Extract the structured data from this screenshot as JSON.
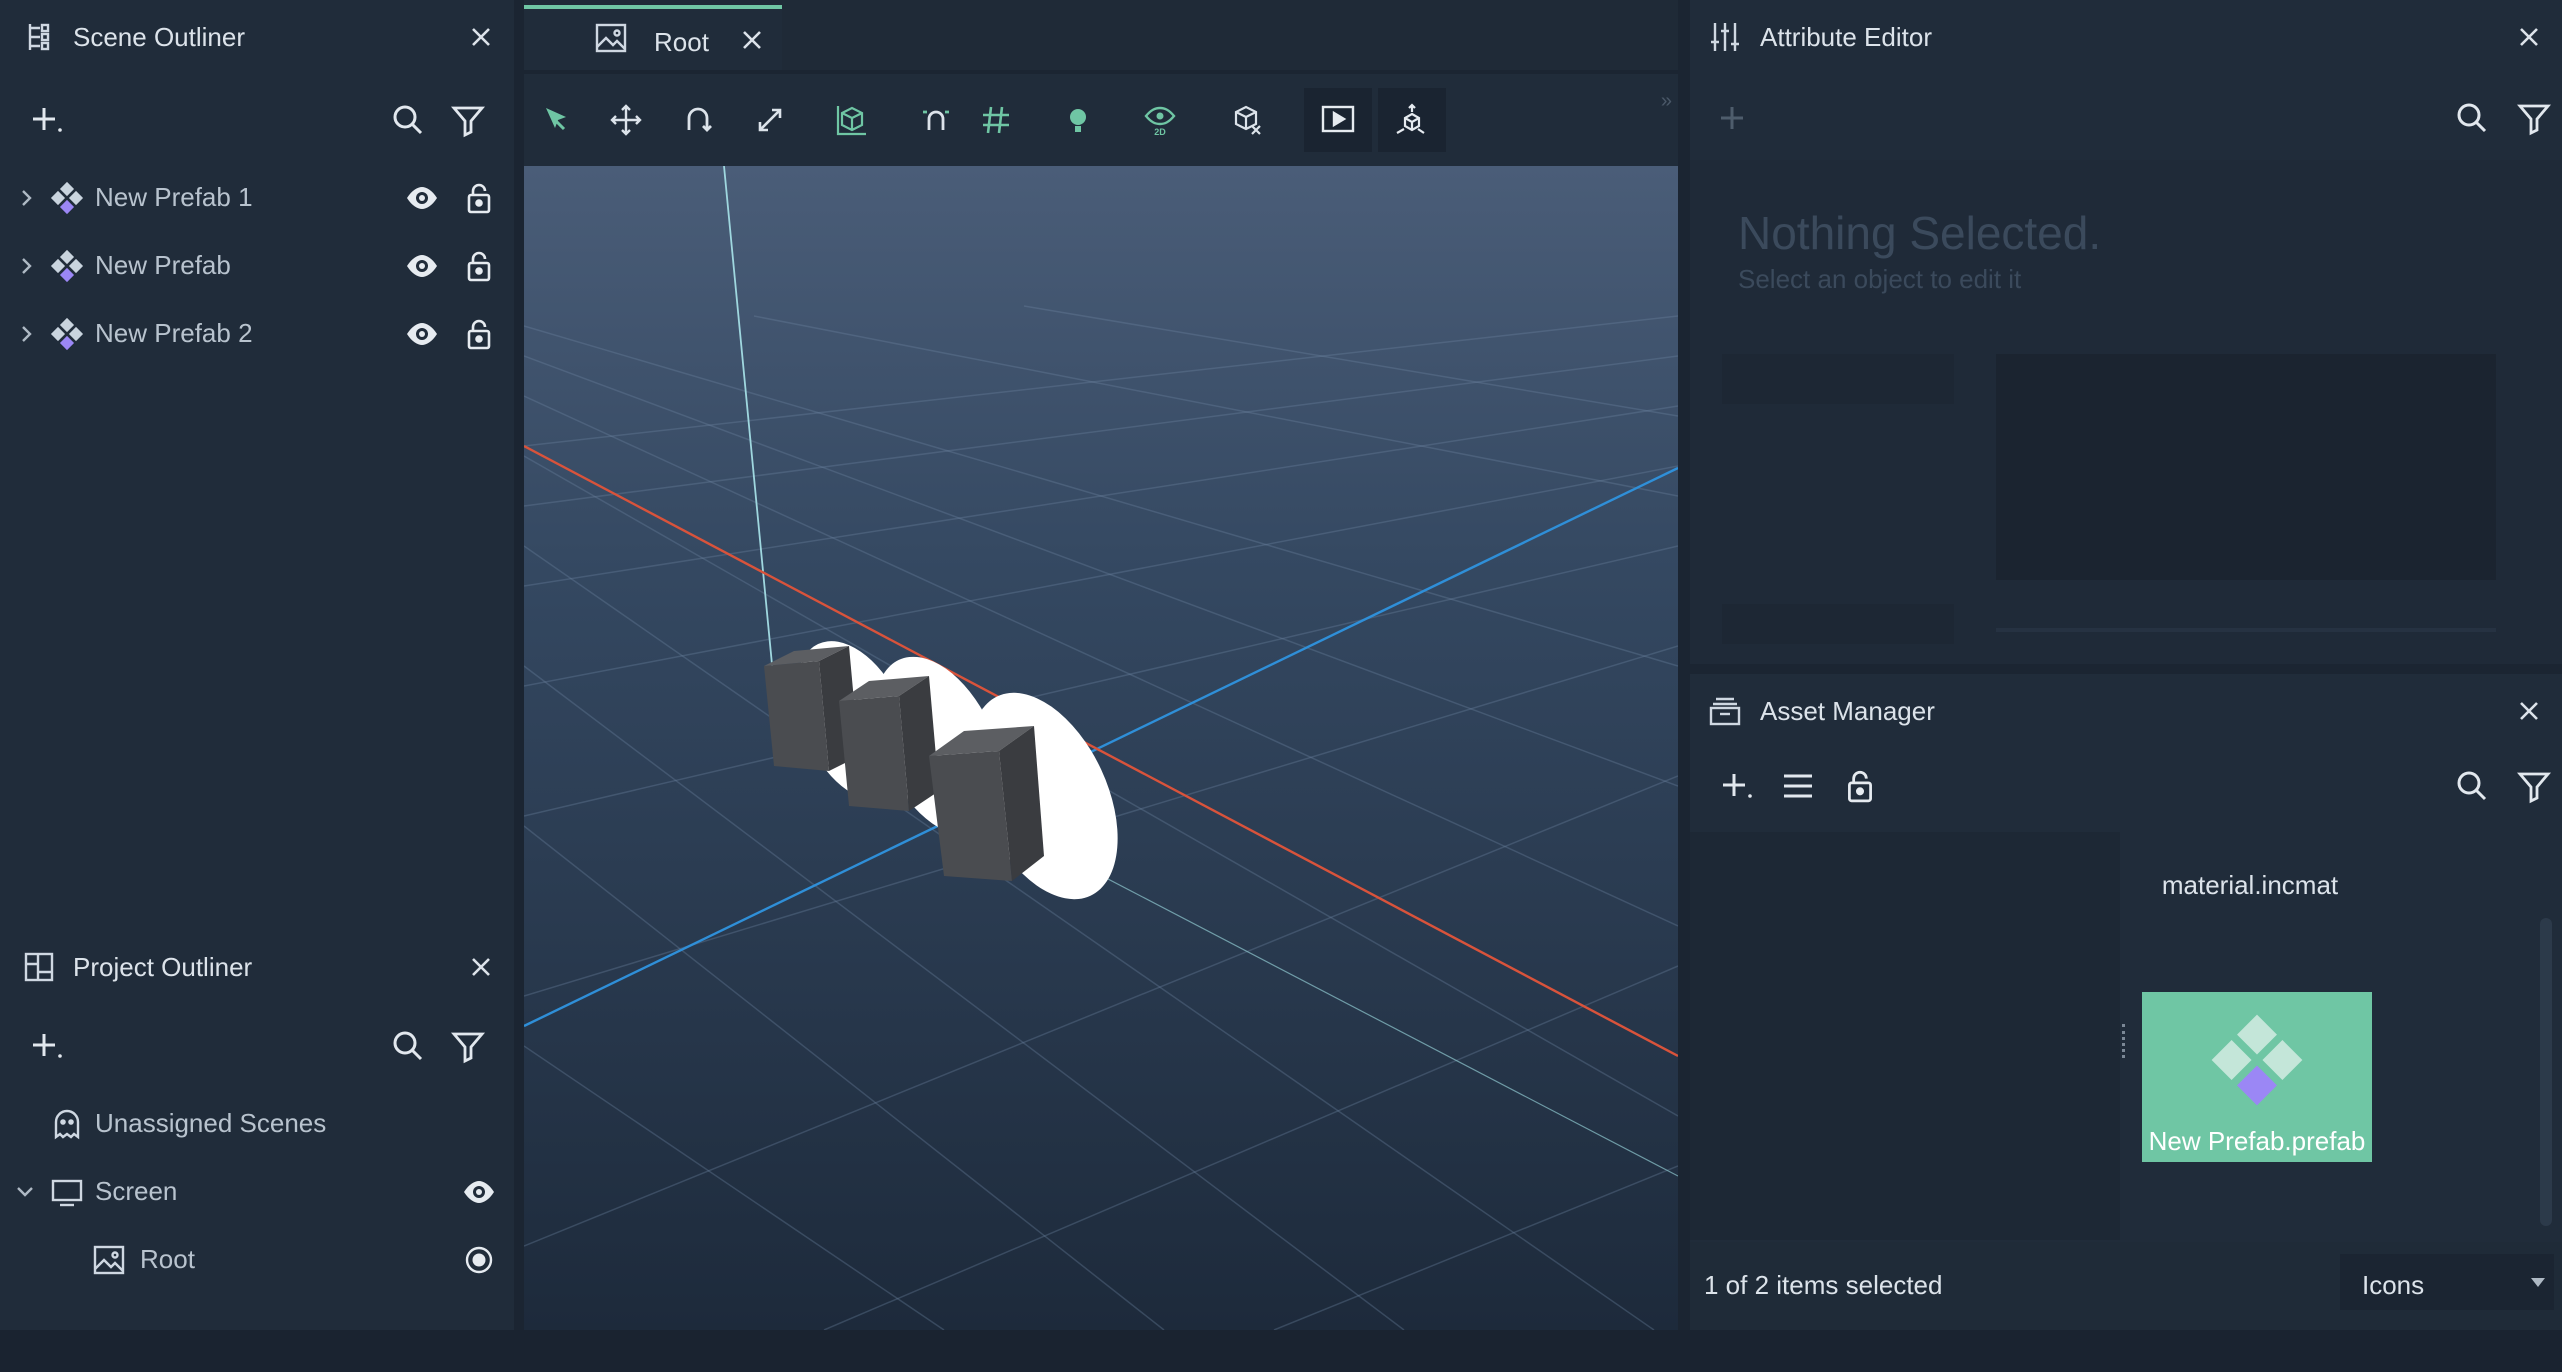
{
  "scene_outliner": {
    "title": "Scene Outliner",
    "items": [
      {
        "label": "New Prefab 1"
      },
      {
        "label": "New Prefab"
      },
      {
        "label": "New Prefab 2"
      }
    ]
  },
  "project_outliner": {
    "title": "Project Outliner",
    "items": [
      {
        "label": "Unassigned Scenes"
      },
      {
        "label": "Screen"
      },
      {
        "label": "Root"
      }
    ]
  },
  "viewport": {
    "tab_label": "Root"
  },
  "attribute_editor": {
    "title": "Attribute Editor",
    "empty_title": "Nothing Selected.",
    "empty_subtitle": "Select an object to edit it"
  },
  "asset_manager": {
    "title": "Asset Manager",
    "assets": [
      {
        "label": "material.incmat"
      },
      {
        "label": "New Prefab.prefab"
      }
    ],
    "status": "1 of 2 items selected",
    "view_mode": "Icons"
  },
  "colors": {
    "accent": "#6fc6a4",
    "panel_bg": "#202c3a",
    "app_bg": "#1b2532",
    "prefab_purple": "#9b87f5",
    "axis_x": "#d9533b",
    "axis_z": "#2f8fd8"
  },
  "icons": [
    "scene-outliner-icon",
    "add-icon",
    "search-icon",
    "filter-icon",
    "chevron-right-icon",
    "prefab-icon",
    "eye-icon",
    "lock-icon",
    "project-outliner-icon",
    "ghost-icon",
    "monitor-icon",
    "image-icon",
    "radio-icon",
    "select-tool-icon",
    "move-tool-icon",
    "rotate-tool-icon",
    "scale-tool-icon",
    "cube-icon",
    "magnet-icon",
    "grid-icon",
    "light-icon",
    "view-2d-icon",
    "hide-icon",
    "play-icon",
    "transform-gizmo-icon",
    "sliders-icon",
    "asset-manager-icon",
    "list-icon",
    "close-icon",
    "dropdown-arrow-icon"
  ]
}
